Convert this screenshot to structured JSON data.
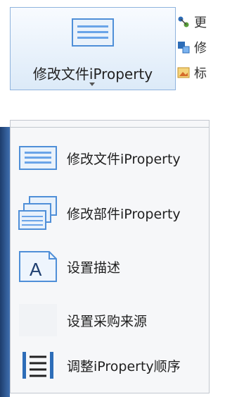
{
  "ribbon": {
    "main_button_label": "修改文件iProperty",
    "small_tools": [
      {
        "label": "更",
        "icon": "node-graph-icon"
      },
      {
        "label": "修",
        "icon": "floppy-tree-icon"
      },
      {
        "label": "标",
        "icon": "picture-edit-icon"
      }
    ]
  },
  "menu": {
    "items": [
      {
        "label": "修改文件iProperty",
        "icon": "spreadsheet-icon"
      },
      {
        "label": "修改部件iProperty",
        "icon": "stacked-spreadsheet-icon"
      },
      {
        "label": "设置描述",
        "icon": "letter-a-document-icon"
      },
      {
        "label": "设置采购来源",
        "icon": "blank-icon"
      },
      {
        "label": "调整iProperty顺序",
        "icon": "list-order-icon"
      }
    ]
  },
  "colors": {
    "accent": "#4f8fd8",
    "menu_background": "#f6f7f9",
    "ribbon_border": "#8fb3dd"
  }
}
